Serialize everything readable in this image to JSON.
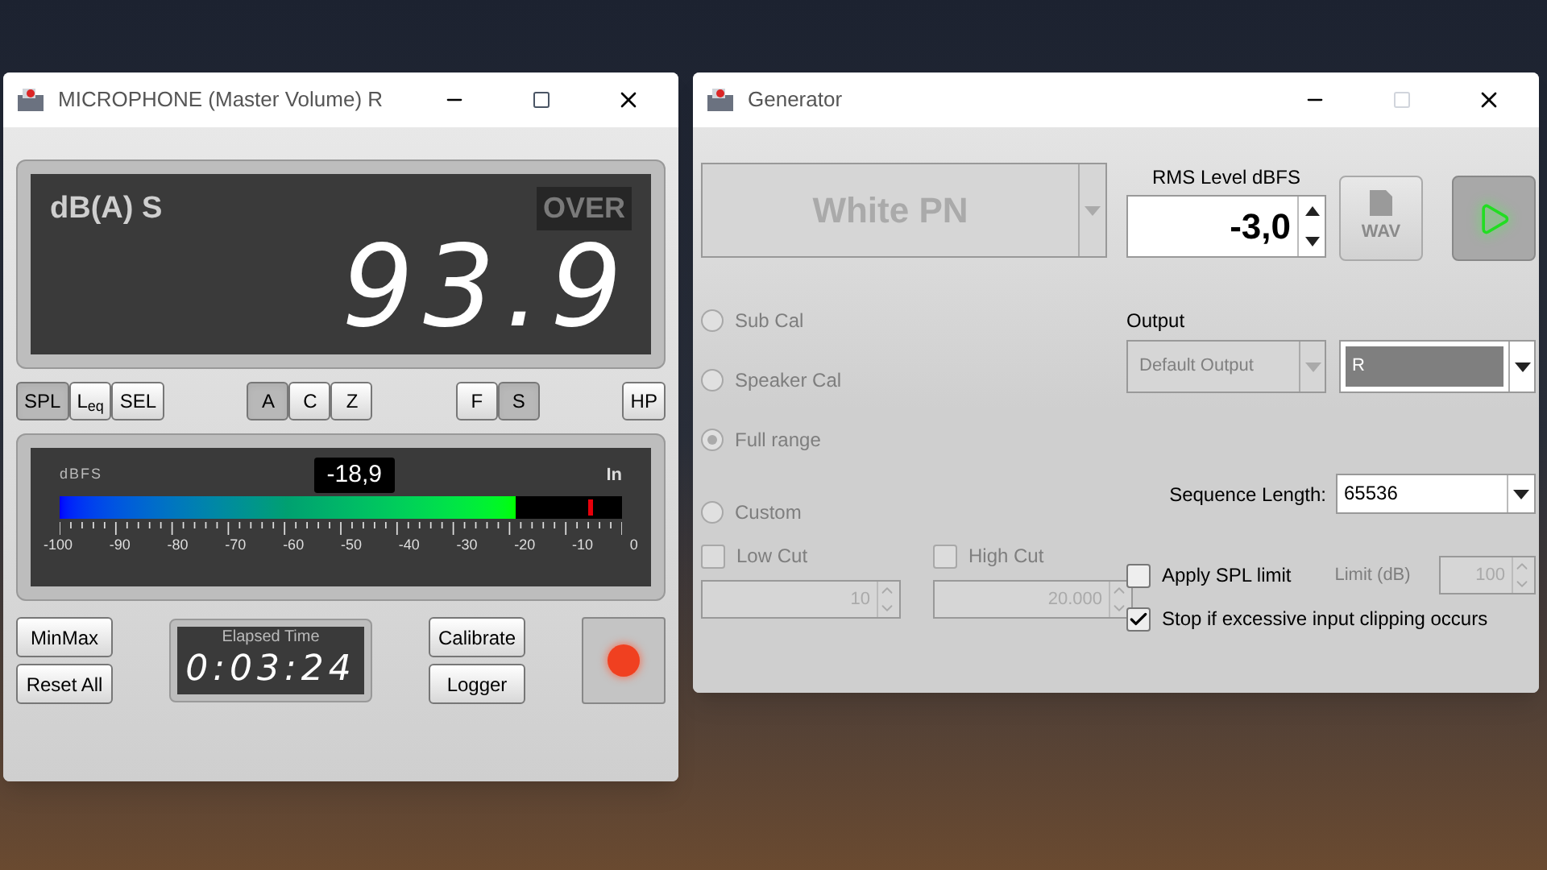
{
  "mic_window": {
    "title": "MICROPHONE (Master Volume) R",
    "display": {
      "mode": "dB(A) S",
      "over": {
        "label": "OVER",
        "on": false
      },
      "reading": "93.9"
    },
    "button_groups": [
      {
        "buttons": [
          {
            "label": "SPL",
            "selected": true
          },
          {
            "label": "L$_{eq}$",
            "selected": false
          },
          {
            "label": "SEL",
            "selected": false
          }
        ]
      },
      {
        "buttons": [
          {
            "label": "A",
            "selected": true
          },
          {
            "label": "C",
            "selected": false
          },
          {
            "label": "Z",
            "selected": false
          }
        ]
      },
      {
        "buttons": [
          {
            "label": "F",
            "selected": false
          },
          {
            "label": "S",
            "selected": true
          }
        ]
      },
      {
        "buttons": [
          {
            "label": "HP",
            "selected": false
          }
        ]
      }
    ],
    "meter": {
      "unit": "dBFS",
      "reading": "-18,9",
      "channel": "In",
      "level": 0.81,
      "peak": {
        "level": 0.94
      },
      "scale": [
        "-100",
        "-90",
        "-80",
        "-70",
        "-60",
        "-50",
        "-40",
        "-30",
        "-20",
        "-10",
        "0"
      ]
    },
    "left_buttons": [
      "MinMax",
      "Reset All"
    ],
    "elapsed": {
      "label": "Elapsed Time",
      "time": "0:03:24"
    },
    "right_buttons": [
      "Calibrate",
      "Logger"
    ],
    "record": {
      "on": true
    }
  },
  "generator_window": {
    "title": "Generator",
    "signal": {
      "value": "White PN",
      "disabled": true
    },
    "rms": {
      "label": "RMS Level dBFS",
      "value": "-3,0"
    },
    "wav_button": {
      "label": "WAV",
      "disabled": true
    },
    "play_button": {
      "on": true
    },
    "modes": [
      {
        "label": "Sub Cal",
        "selected": false,
        "disabled": true
      },
      {
        "label": "Speaker Cal",
        "selected": false,
        "disabled": true
      },
      {
        "label": "Full range",
        "selected": true,
        "disabled": true
      },
      {
        "label": "Custom",
        "selected": false,
        "disabled": true
      }
    ],
    "output": {
      "label": "Output",
      "device": {
        "value": "Default Output",
        "disabled": true
      },
      "channel": {
        "value": "R"
      }
    },
    "sequence": {
      "label": "Sequence Length:",
      "value": "65536"
    },
    "filters": [
      {
        "label": "Low Cut",
        "checked": false,
        "disabled": true,
        "value": "10"
      },
      {
        "label": "High Cut",
        "checked": false,
        "disabled": true,
        "value": "20.000"
      }
    ],
    "spl_limit": {
      "label": "Apply SPL limit",
      "checked": false,
      "limit_label": "Limit (dB)",
      "limit_value": "100",
      "limit_disabled": true
    },
    "clipping": {
      "label": "Stop if excessive input clipping occurs",
      "checked": true
    }
  }
}
